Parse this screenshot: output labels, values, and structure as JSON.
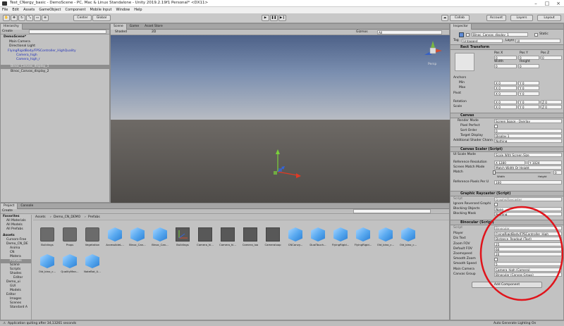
{
  "window": {
    "title": "Test_CNergy_basic - DemoScene - PC, Mac & Linux Standalone - Unity 2019.2.19f1 Personal* <DX11>"
  },
  "menu": [
    "File",
    "Edit",
    "Assets",
    "GameObject",
    "Component",
    "Mobile Input",
    "Window",
    "Help"
  ],
  "toolbar": {
    "center": "Center",
    "global": "Global",
    "collab": "Collab",
    "account": "Account",
    "layers": "Layers",
    "layout": "Layout"
  },
  "hierarchy": {
    "tab": "Hierarchy",
    "create": "Create",
    "items": [
      {
        "label": "DemoScene*"
      },
      {
        "label": "Main Camera"
      },
      {
        "label": "Directional Light"
      },
      {
        "label": "FlyingRigidBody/FPSController_HighQuality"
      },
      {
        "label": "Camera_high"
      },
      {
        "label": "Camera_high_r"
      },
      {
        "label": "Binoc_Canvas_display_1"
      },
      {
        "label": "Binoc_Canvas_display_2"
      }
    ]
  },
  "scene": {
    "tabs": [
      "Scene",
      "Game",
      "Asset Store"
    ],
    "shading": "Shaded",
    "mode2d": "2D",
    "gizmos": "Gizmos",
    "search": "All",
    "persp": "Persp"
  },
  "project": {
    "tabs": [
      "Project",
      "Console"
    ],
    "create": "Create",
    "breadcrumb": [
      "Assets",
      "Demo_CN_DEMO",
      "Prefabs"
    ],
    "tree": [
      {
        "label": "Favorites"
      },
      {
        "label": "All Materials"
      },
      {
        "label": "All Models"
      },
      {
        "label": "All Prefabs"
      },
      {
        "label": "Assets"
      },
      {
        "label": "Cursors-Free"
      },
      {
        "label": "Demo_CN_DE"
      },
      {
        "label": "Anima"
      },
      {
        "label": "CN"
      },
      {
        "label": "Matera"
      },
      {
        "label": "Prefabs"
      },
      {
        "label": "Scene"
      },
      {
        "label": "Scripts"
      },
      {
        "label": "Shades"
      },
      {
        "label": "Editor"
      },
      {
        "label": "Demo_ui"
      },
      {
        "label": "GUI"
      },
      {
        "label": "Models"
      },
      {
        "label": "Editor"
      },
      {
        "label": "Images"
      },
      {
        "label": "Scenes"
      },
      {
        "label": "Standard A"
      }
    ],
    "assets": [
      {
        "label": "Buildings",
        "kind": "folder"
      },
      {
        "label": "Props",
        "kind": "folder"
      },
      {
        "label": "Vegetation",
        "kind": "folder"
      },
      {
        "label": "AccessibleL...",
        "kind": "cube"
      },
      {
        "label": "Binoc_Can...",
        "kind": "cube"
      },
      {
        "label": "Binoc_Can...",
        "kind": "cube"
      },
      {
        "label": "Buildings",
        "kind": "gizmo"
      },
      {
        "label": "Camera_hi...",
        "kind": "mat"
      },
      {
        "label": "Camera_hi...",
        "kind": "mat"
      },
      {
        "label": "Camera_loo",
        "kind": "mat"
      },
      {
        "label": "Cameraloop",
        "kind": "mat"
      },
      {
        "label": "CNCanvy...",
        "kind": "cube"
      },
      {
        "label": "DualTouch...",
        "kind": "cube"
      },
      {
        "label": "FlyingRigid...",
        "kind": "cube"
      },
      {
        "label": "FlyingRigid...",
        "kind": "cube"
      },
      {
        "label": "Old_bino_c...",
        "kind": "cube"
      },
      {
        "label": "Old_bino_c...",
        "kind": "cube"
      },
      {
        "label": "Old_bino_c...",
        "kind": "cube"
      },
      {
        "label": "QualityMan...",
        "kind": "cube"
      },
      {
        "label": "NoteBot_U...",
        "kind": "cube"
      }
    ]
  },
  "inspector": {
    "tabs": [
      "Inspector"
    ],
    "object_name": "Binoc_Canvas_display_1",
    "static": "Static",
    "tag_label": "Tag",
    "tag": "Untagged",
    "layer_label": "Layer",
    "layer": "UI",
    "rect_transform": {
      "title": "Rect Transform",
      "posx_label": "Pos X",
      "posy_label": "Pos Y",
      "posz_label": "Pos Z",
      "posx": "0",
      "posy": "0",
      "posz": "0",
      "width_label": "Width",
      "height_label": "Height",
      "width": "0",
      "height": "0",
      "anchors": "Anchors",
      "min": "Min",
      "max": "Max",
      "pivot": "Pivot",
      "min_x": "0",
      "min_y": "0",
      "max_x": "0",
      "max_y": "0",
      "pivot_x": "0",
      "pivot_y": "0",
      "rotation": "Rotation",
      "scale": "Scale",
      "rot_x": "0",
      "rot_y": "0",
      "rot_z": "0",
      "scale_x": "0",
      "scale_y": "0",
      "scale_z": "0",
      "x": "X",
      "y": "Y",
      "z": "Z"
    },
    "canvas": {
      "title": "Canvas",
      "render_mode_label": "Render Mode",
      "render_mode": "Screen Space - Overlay",
      "pixel_perfect": "Pixel Perfect",
      "sort_order_label": "Sort Order",
      "sort_order": "0",
      "target_display_label": "Target Display",
      "target_display": "Display 1",
      "shader_channels_label": "Additional Shader Chann",
      "shader_channels": "Nothing"
    },
    "canvas_scaler": {
      "title": "Canvas Scaler (Script)",
      "ui_scale_label": "UI Scale Mode",
      "ui_scale": "Scale With Screen Size",
      "ref_res_label": "Reference Resolution",
      "ref_x": "X 1280",
      "ref_y": "Y 1024",
      "match_mode_label": "Screen Match Mode",
      "match_mode": "Match Width Or Height",
      "match_label": "Match",
      "match_val": "0",
      "width": "Width",
      "height": "Height",
      "ppu_label": "Reference Pixels Per U",
      "ppu": "100"
    },
    "raycaster": {
      "title": "Graphic Raycaster (Script)",
      "script_label": "Script",
      "script": "GraphicRaycaster",
      "ignore_label": "Ignore Reversed Graphi",
      "blocking_label": "Blocking Objects",
      "blocking": "None",
      "mask_label": "Blocking Mask",
      "mask": "Nothing"
    },
    "binocular": {
      "title": "Binocular (Script)",
      "script_label": "Script",
      "script": "Binocular",
      "player_label": "Player",
      "player": "FlyingRigidBody/FPSController_High",
      "dis_text_label": "Dis Text",
      "dis_text": "Distance_Readout (Text)",
      "zoom_fov_label": "Zoom FOV",
      "zoom_fov": "25",
      "default_fov_label": "Default FOV",
      "default_fov": "60",
      "zoomspeed_label": "Zoomspeed",
      "zoomspeed": "20",
      "smooth_zoom_label": "Smooth Zoom",
      "smooth_speed_label": "Smooth Speed",
      "smooth_speed": "5",
      "main_camera_label": "Main Camera",
      "main_camera": "Camera_high (Camera)",
      "canvas_group_label": "Canvas Group",
      "canvas_group": "Binocular (Canvas Group)"
    },
    "add_component": "Add Component"
  },
  "status": {
    "message": "Application quiting after 34,13261 seconds",
    "right": "Auto Generate Lighting On"
  },
  "colors": {
    "highlight_circle": "#e0141b",
    "selection_blue": "#8cb1e6"
  }
}
